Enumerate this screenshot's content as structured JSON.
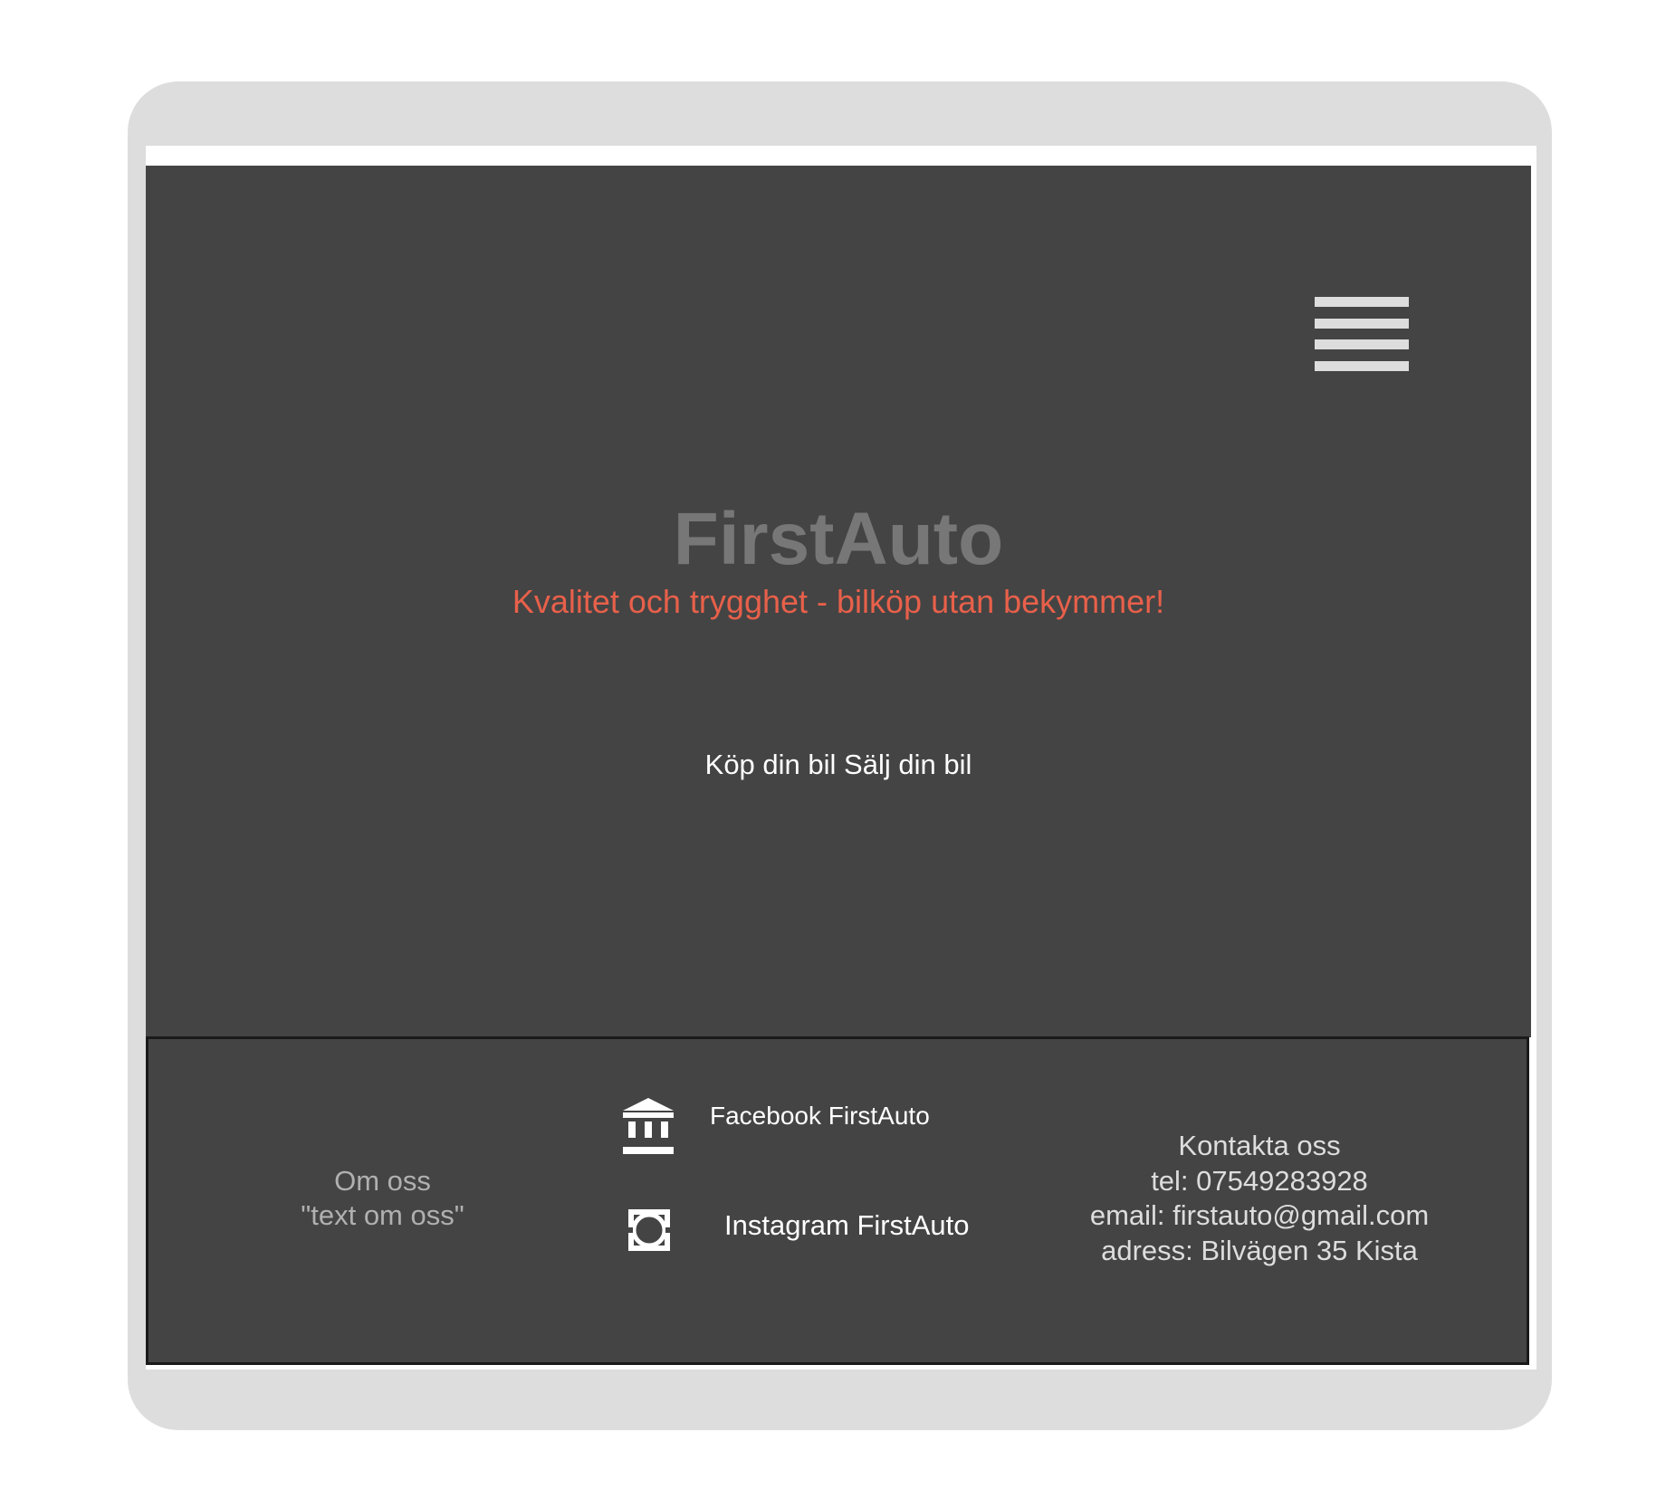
{
  "header": {
    "menu_icon": "hamburger-menu-icon"
  },
  "hero": {
    "title": "FirstAuto",
    "tagline": "Kvalitet och trygghet - bilköp utan bekymmer!",
    "nav": {
      "buy_label": "Köp din bil",
      "sell_label": "Sälj din bil"
    }
  },
  "footer": {
    "about": {
      "heading": "Om oss",
      "text": "\"text om oss\""
    },
    "social": {
      "facebook": {
        "icon": "bank-building-icon",
        "label": "Facebook FirstAuto"
      },
      "instagram": {
        "icon": "broken-image-frame-icon",
        "label": "Instagram FirstAuto"
      }
    },
    "contact": {
      "heading": "Kontakta oss",
      "tel": "tel: 07549283928",
      "email": "email: firstauto@gmail.com",
      "address": "adress: Bilvägen 35 Kista"
    }
  },
  "colors": {
    "frame": "#dddddd",
    "background": "#444444",
    "title": "#777777",
    "tagline": "#e8604a",
    "text_light": "#ffffff",
    "about_text": "#b0b0b0"
  }
}
